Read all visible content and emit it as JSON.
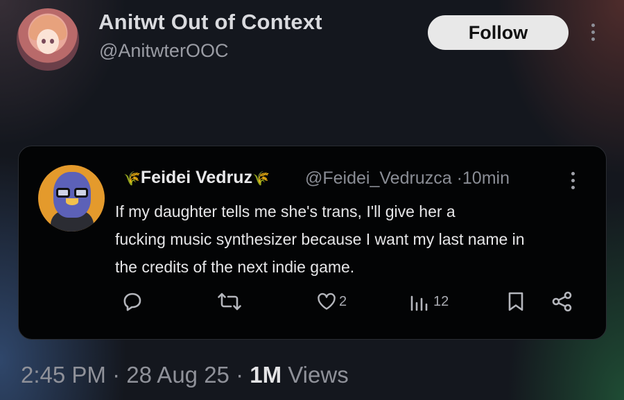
{
  "author": {
    "display_name": "Anitwt Out of Context",
    "handle": "@AnitwterOOC",
    "follow_label": "Follow"
  },
  "quoted": {
    "display_name": "Feidei Vedruz",
    "name_emoji": "🌾",
    "handle": "@Feidei_Vedruzca",
    "separator": "·",
    "time": "10min",
    "text_lines": [
      "If my daughter tells me she's trans, I'll give her a",
      "fucking music synthesizer because I want my last name in",
      "the credits of the next indie game."
    ],
    "actions": {
      "reply_icon": "reply-icon",
      "retweet_icon": "retweet-icon",
      "like_count": "2",
      "views_count": "12",
      "bookmark_icon": "bookmark-icon",
      "share_icon": "share-icon"
    }
  },
  "post_meta": {
    "time": "2:45 PM",
    "sep1": "·",
    "date": "28 Aug 25",
    "sep2": "·",
    "views_count": "1M",
    "views_label": "Views"
  },
  "colors": {
    "background": "#14171e",
    "card": "#030405",
    "follow_button": "#e8e8e8"
  }
}
